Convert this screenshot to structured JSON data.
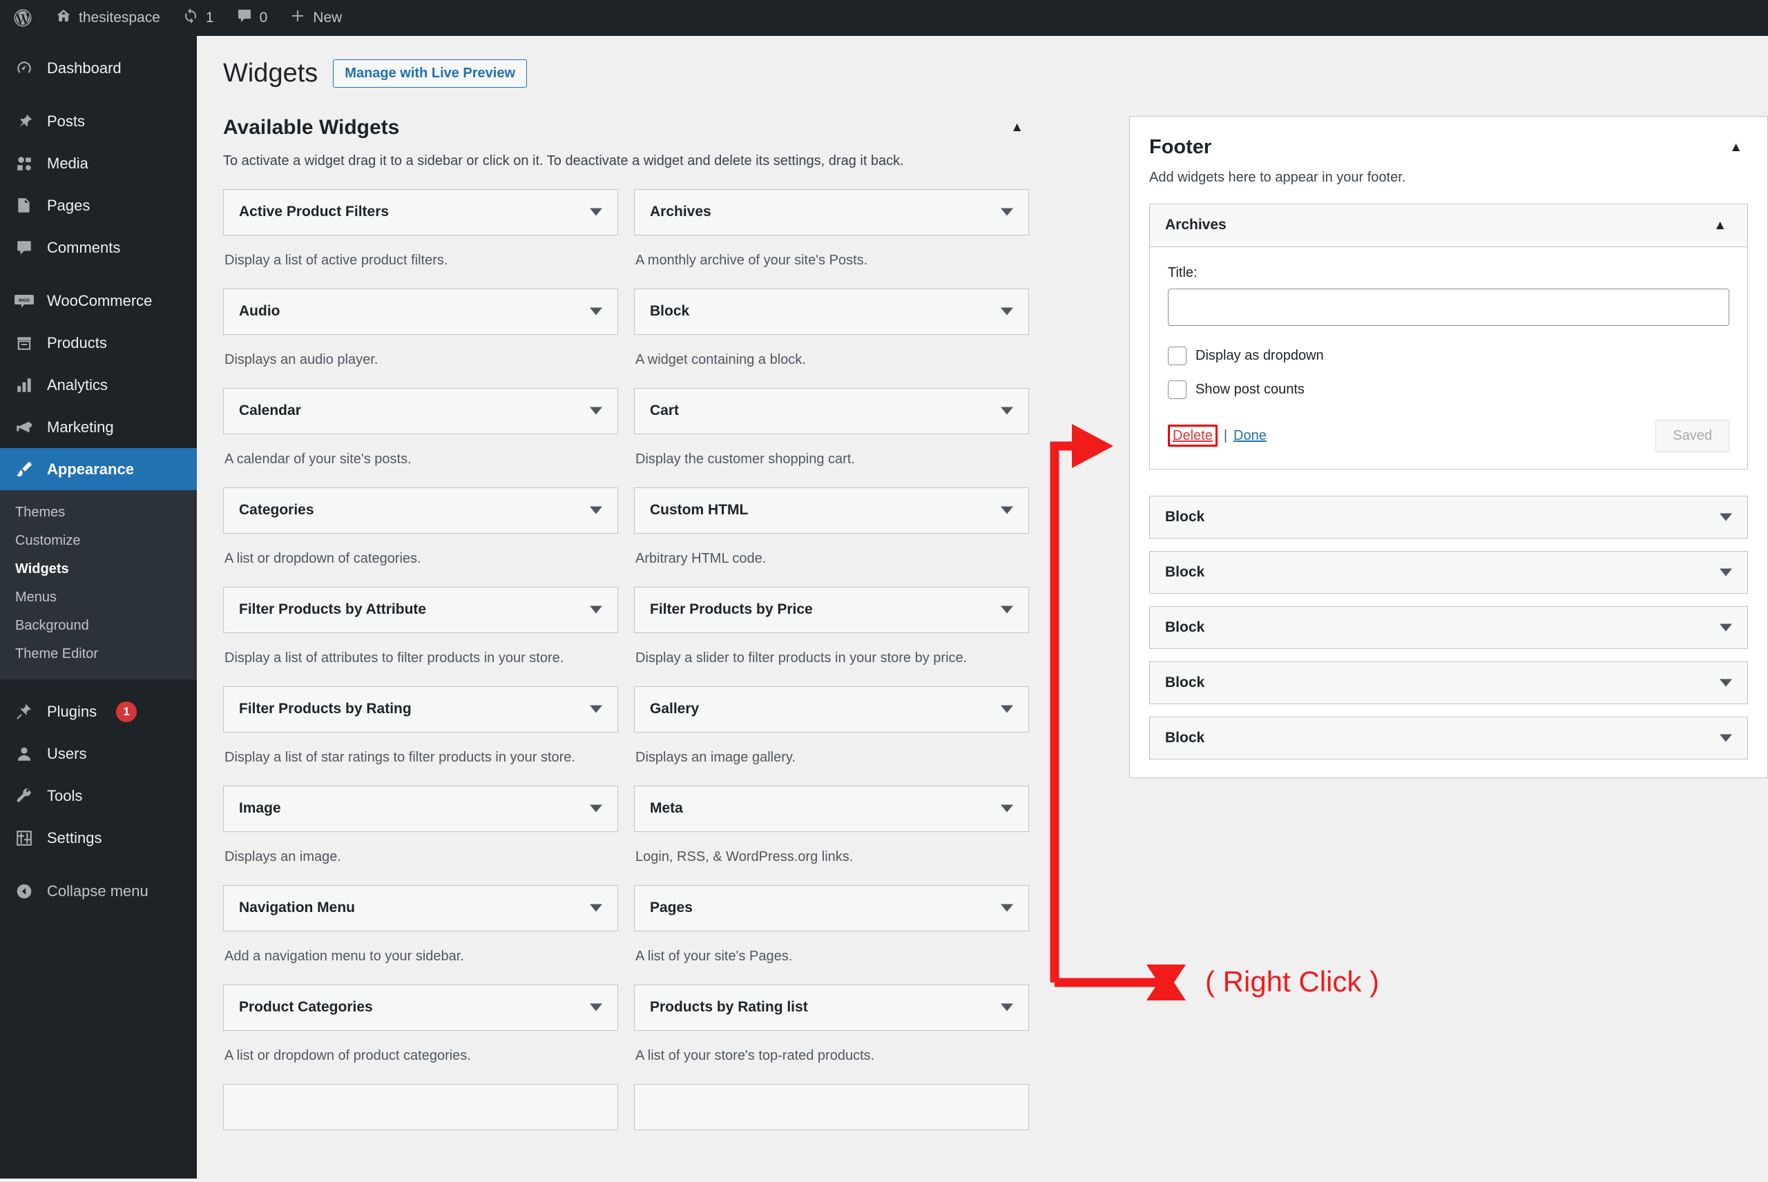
{
  "admin_bar": {
    "logo_icon": "wordpress-logo-icon",
    "site": {
      "icon": "home-icon",
      "label": "thesitespace"
    },
    "updates": {
      "icon": "updates-icon",
      "count": "1"
    },
    "comments": {
      "icon": "comment-bubble-icon",
      "count": "0"
    },
    "new": {
      "icon": "plus-icon",
      "label": "New"
    }
  },
  "sidebar": {
    "items": [
      {
        "label": "Dashboard",
        "icon": "dashboard-icon",
        "current": false,
        "badge": ""
      },
      {
        "label": "Posts",
        "icon": "pin-icon",
        "current": false,
        "badge": ""
      },
      {
        "label": "Media",
        "icon": "media-icon",
        "current": false,
        "badge": ""
      },
      {
        "label": "Pages",
        "icon": "pages-icon",
        "current": false,
        "badge": ""
      },
      {
        "label": "Comments",
        "icon": "comment-bubble-icon",
        "current": false,
        "badge": ""
      },
      {
        "label": "WooCommerce",
        "icon": "woocommerce-icon",
        "current": false,
        "badge": ""
      },
      {
        "label": "Products",
        "icon": "products-icon",
        "current": false,
        "badge": ""
      },
      {
        "label": "Analytics",
        "icon": "bar-chart-icon",
        "current": false,
        "badge": ""
      },
      {
        "label": "Marketing",
        "icon": "megaphone-icon",
        "current": false,
        "badge": ""
      },
      {
        "label": "Appearance",
        "icon": "paintbrush-icon",
        "current": true,
        "badge": ""
      },
      {
        "label": "Plugins",
        "icon": "plug-icon",
        "current": false,
        "badge": "1"
      },
      {
        "label": "Users",
        "icon": "user-icon",
        "current": false,
        "badge": ""
      },
      {
        "label": "Tools",
        "icon": "wrench-icon",
        "current": false,
        "badge": ""
      },
      {
        "label": "Settings",
        "icon": "sliders-icon",
        "current": false,
        "badge": ""
      }
    ],
    "submenu": [
      {
        "label": "Themes",
        "current": false
      },
      {
        "label": "Customize",
        "current": false
      },
      {
        "label": "Widgets",
        "current": true
      },
      {
        "label": "Menus",
        "current": false
      },
      {
        "label": "Background",
        "current": false
      },
      {
        "label": "Theme Editor",
        "current": false
      }
    ],
    "collapse": {
      "label": "Collapse menu",
      "icon": "collapse-arrow-icon"
    }
  },
  "header": {
    "title": "Widgets",
    "live_preview_button": "Manage with Live Preview"
  },
  "available_widgets": {
    "title": "Available Widgets",
    "toggle_icon": "chevron-up-icon",
    "description": "To activate a widget drag it to a sidebar or click on it. To deactivate a widget and delete its settings, drag it back.",
    "left_column": [
      {
        "name": "Active Product Filters",
        "desc": "Display a list of active product filters."
      },
      {
        "name": "Audio",
        "desc": "Displays an audio player."
      },
      {
        "name": "Calendar",
        "desc": "A calendar of your site's posts."
      },
      {
        "name": "Categories",
        "desc": "A list or dropdown of categories."
      },
      {
        "name": "Filter Products by Attribute",
        "desc": "Display a list of attributes to filter products in your store."
      },
      {
        "name": "Filter Products by Rating",
        "desc": "Display a list of star ratings to filter products in your store."
      },
      {
        "name": "Image",
        "desc": "Displays an image."
      },
      {
        "name": "Navigation Menu",
        "desc": "Add a navigation menu to your sidebar."
      },
      {
        "name": "Product Categories",
        "desc": "A list or dropdown of product categories."
      }
    ],
    "right_column": [
      {
        "name": "Archives",
        "desc": "A monthly archive of your site's Posts."
      },
      {
        "name": "Block",
        "desc": "A widget containing a block."
      },
      {
        "name": "Cart",
        "desc": "Display the customer shopping cart."
      },
      {
        "name": "Custom HTML",
        "desc": "Arbitrary HTML code."
      },
      {
        "name": "Filter Products by Price",
        "desc": "Display a slider to filter products in your store by price."
      },
      {
        "name": "Gallery",
        "desc": "Displays an image gallery."
      },
      {
        "name": "Meta",
        "desc": "Login, RSS, & WordPress.org links."
      },
      {
        "name": "Pages",
        "desc": "A list of your site's Pages."
      },
      {
        "name": "Products by Rating list",
        "desc": "A list of your store's top-rated products."
      }
    ]
  },
  "footer_panel": {
    "title": "Footer",
    "toggle_icon": "chevron-up-icon",
    "description": "Add widgets here to appear in your footer.",
    "open_widget": {
      "name": "Archives",
      "toggle_icon": "chevron-up-icon",
      "title_label": "Title:",
      "title_value": "",
      "title_placeholder": "",
      "checkboxes": [
        {
          "label": "Display as dropdown",
          "checked": false
        },
        {
          "label": "Show post counts",
          "checked": false
        }
      ],
      "delete_link": "Delete",
      "separator": "|",
      "done_link": "Done",
      "save_button": "Saved"
    },
    "closed_widgets": [
      {
        "name": "Block"
      },
      {
        "name": "Block"
      },
      {
        "name": "Block"
      },
      {
        "name": "Block"
      },
      {
        "name": "Block"
      }
    ]
  },
  "annotation": {
    "label": "( Right Click )",
    "color": "#f21b1b",
    "arrow_icon": "callout-arrow-icon",
    "highlight_target": "Delete"
  },
  "colors": {
    "admin_dark": "#1d2327",
    "admin_submenu": "#2c3338",
    "accent_blue": "#2271b1",
    "page_bg": "#f0f0f1",
    "badge_red": "#d63638",
    "annotation_red": "#f21b1b",
    "delete_red": "#d63638"
  }
}
